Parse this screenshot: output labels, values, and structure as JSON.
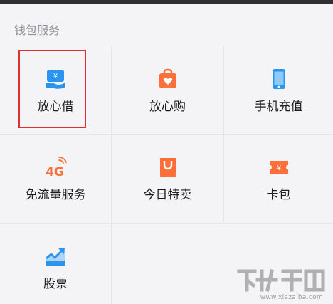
{
  "section": {
    "title": "钱包服务"
  },
  "services": [
    {
      "label": "放心借",
      "icon": "loan-yen-hand-icon"
    },
    {
      "label": "放心购",
      "icon": "shopping-bag-heart-icon"
    },
    {
      "label": "手机充值",
      "icon": "phone-topup-icon"
    },
    {
      "label": "免流量服务",
      "icon": "4g-signal-icon"
    },
    {
      "label": "今日特卖",
      "icon": "sale-bag-icon"
    },
    {
      "label": "卡包",
      "icon": "card-ticket-icon"
    },
    {
      "label": "股票",
      "icon": "stock-chart-icon"
    }
  ],
  "colors": {
    "blue": "#2a94f0",
    "orange": "#ff6f3c",
    "highlight": "#e0312e"
  },
  "watermark": {
    "site": "www.xiazaiba.com"
  }
}
